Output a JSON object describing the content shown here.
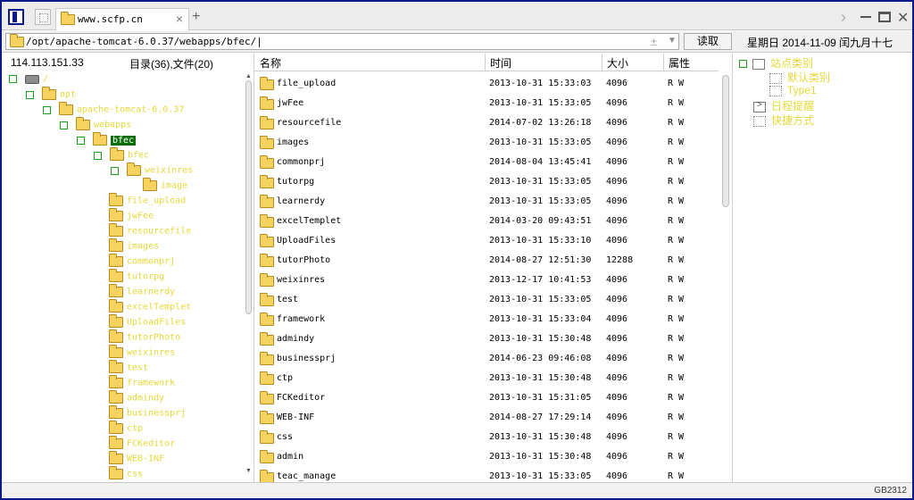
{
  "tab": {
    "title": "www.scfp.cn",
    "close": "×",
    "add": "+"
  },
  "address": {
    "path": "/opt/apache-tomcat-6.0.37/webapps/bfec/|",
    "plus": "±",
    "drop": "▼"
  },
  "read_button": "读取",
  "date_text": "星期日 2014-11-09 闰九月十七",
  "left_panel": {
    "ip": "114.113.151.33",
    "dir_count": "目录(36),文件(20)",
    "tree": [
      {
        "label": "/",
        "icon": "drive-icon"
      },
      {
        "label": "opt",
        "icon": "folder-icon"
      },
      {
        "label": "apache-tomcat-6.0.37",
        "icon": "folder-icon"
      },
      {
        "label": "webapps",
        "icon": "folder-icon"
      },
      {
        "label": "bfec",
        "icon": "folder-icon"
      },
      {
        "label": "bfec",
        "icon": "folder-icon"
      },
      {
        "label": "weixinres",
        "icon": "folder-icon"
      },
      {
        "label": "image",
        "icon": "folder-icon"
      },
      {
        "label": "file_upload",
        "icon": "folder-icon"
      },
      {
        "label": "jwFee",
        "icon": "folder-icon"
      },
      {
        "label": "resourcefile",
        "icon": "folder-icon"
      },
      {
        "label": "images",
        "icon": "folder-icon"
      },
      {
        "label": "commonprj",
        "icon": "folder-icon"
      },
      {
        "label": "tutorpg",
        "icon": "folder-icon"
      },
      {
        "label": "learnerdy",
        "icon": "folder-icon"
      },
      {
        "label": "excelTemplet",
        "icon": "folder-icon"
      },
      {
        "label": "UploadFiles",
        "icon": "folder-icon"
      },
      {
        "label": "tutorPhoto",
        "icon": "folder-icon"
      },
      {
        "label": "weixinres",
        "icon": "folder-icon"
      },
      {
        "label": "test",
        "icon": "folder-icon"
      },
      {
        "label": "framework",
        "icon": "folder-icon"
      },
      {
        "label": "admindy",
        "icon": "folder-icon"
      },
      {
        "label": "businessprj",
        "icon": "folder-icon"
      },
      {
        "label": "ctp",
        "icon": "folder-icon"
      },
      {
        "label": "FCKeditor",
        "icon": "folder-icon"
      },
      {
        "label": "WEB-INF",
        "icon": "folder-icon"
      },
      {
        "label": "css",
        "icon": "folder-icon"
      }
    ]
  },
  "table": {
    "headers": {
      "name": "名称",
      "time": "时间",
      "size": "大小",
      "attr": "属性"
    },
    "rows": [
      {
        "name": "file_upload",
        "time": "2013-10-31 15:33:03",
        "size": "4096",
        "attr": "R W"
      },
      {
        "name": "jwFee",
        "time": "2013-10-31 15:33:05",
        "size": "4096",
        "attr": "R W"
      },
      {
        "name": "resourcefile",
        "time": "2014-07-02 13:26:18",
        "size": "4096",
        "attr": "R W"
      },
      {
        "name": "images",
        "time": "2013-10-31 15:33:05",
        "size": "4096",
        "attr": "R W"
      },
      {
        "name": "commonprj",
        "time": "2014-08-04 13:45:41",
        "size": "4096",
        "attr": "R W"
      },
      {
        "name": "tutorpg",
        "time": "2013-10-31 15:33:05",
        "size": "4096",
        "attr": "R W"
      },
      {
        "name": "learnerdy",
        "time": "2013-10-31 15:33:05",
        "size": "4096",
        "attr": "R W"
      },
      {
        "name": "excelTemplet",
        "time": "2014-03-20 09:43:51",
        "size": "4096",
        "attr": "R W"
      },
      {
        "name": "UploadFiles",
        "time": "2013-10-31 15:33:10",
        "size": "4096",
        "attr": "R W"
      },
      {
        "name": "tutorPhoto",
        "time": "2014-08-27 12:51:30",
        "size": "12288",
        "attr": "R W"
      },
      {
        "name": "weixinres",
        "time": "2013-12-17 10:41:53",
        "size": "4096",
        "attr": "R W"
      },
      {
        "name": "test",
        "time": "2013-10-31 15:33:05",
        "size": "4096",
        "attr": "R W"
      },
      {
        "name": "framework",
        "time": "2013-10-31 15:33:04",
        "size": "4096",
        "attr": "R W"
      },
      {
        "name": "admindy",
        "time": "2013-10-31 15:30:48",
        "size": "4096",
        "attr": "R W"
      },
      {
        "name": "businessprj",
        "time": "2014-06-23 09:46:08",
        "size": "4096",
        "attr": "R W"
      },
      {
        "name": "ctp",
        "time": "2013-10-31 15:30:48",
        "size": "4096",
        "attr": "R W"
      },
      {
        "name": "FCKeditor",
        "time": "2013-10-31 15:31:05",
        "size": "4096",
        "attr": "R W"
      },
      {
        "name": "WEB-INF",
        "time": "2014-08-27 17:29:14",
        "size": "4096",
        "attr": "R W"
      },
      {
        "name": "css",
        "time": "2013-10-31 15:30:48",
        "size": "4096",
        "attr": "R W"
      },
      {
        "name": "admin",
        "time": "2013-10-31 15:30:48",
        "size": "4096",
        "attr": "R W"
      },
      {
        "name": "teac_manage",
        "time": "2013-10-31 15:33:05",
        "size": "4096",
        "attr": "R W"
      }
    ]
  },
  "right_panel": {
    "items": [
      {
        "label": "站点类别",
        "icon": "site-category-icon"
      },
      {
        "label": "默认类别",
        "icon": "default-category-icon"
      },
      {
        "label": "Type1",
        "icon": "type-icon"
      },
      {
        "label": "日程提醒",
        "icon": "calendar-icon"
      },
      {
        "label": "快捷方式",
        "icon": "shortcut-icon"
      }
    ]
  },
  "status": {
    "encoding": "GB2312"
  },
  "colors": {
    "tree_text": "#e4d83a",
    "selected_bg": "#0a6f0a",
    "frame": "#0b1a8a"
  }
}
